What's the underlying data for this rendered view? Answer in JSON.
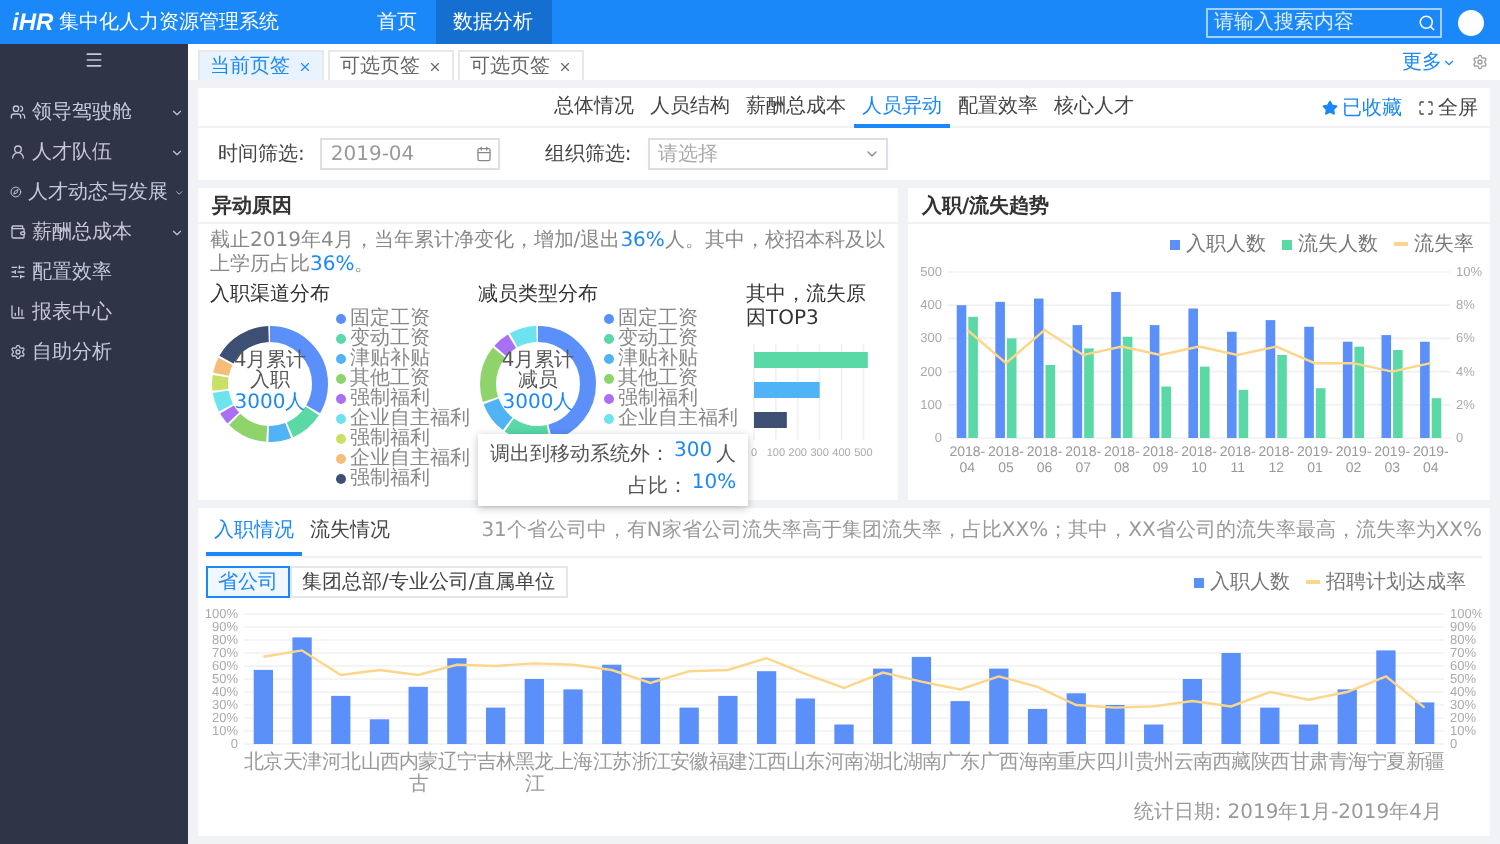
{
  "header": {
    "logo": "iHR",
    "title": "集中化人力资源管理系统",
    "nav": [
      {
        "label": "首页",
        "selected": false
      },
      {
        "label": "数据分析",
        "selected": true
      }
    ],
    "search": {
      "placeholder": "请输入搜索内容"
    }
  },
  "sidebar": {
    "items": [
      {
        "label": "领导驾驶舱",
        "expandable": true
      },
      {
        "label": "人才队伍",
        "expandable": true
      },
      {
        "label": "人才动态与发展",
        "expandable": true
      },
      {
        "label": "薪酬总成本",
        "expandable": true
      },
      {
        "label": "配置效率",
        "expandable": false
      },
      {
        "label": "报表中心",
        "expandable": false
      },
      {
        "label": "自助分析",
        "expandable": false
      }
    ]
  },
  "page_tabs": [
    {
      "label": "当前页签",
      "selected": true
    },
    {
      "label": "可选页签",
      "selected": false
    },
    {
      "label": "可选页签",
      "selected": false
    }
  ],
  "more": "更多",
  "subnav": {
    "tabs": [
      {
        "label": "总体情况",
        "selected": false
      },
      {
        "label": "人员结构",
        "selected": false
      },
      {
        "label": "薪酬总成本",
        "selected": false
      },
      {
        "label": "人员异动",
        "selected": true
      },
      {
        "label": "配置效率",
        "selected": false
      },
      {
        "label": "核心人才",
        "selected": false
      }
    ],
    "favorite": "已收藏",
    "fullscreen": "全屏"
  },
  "filters": [
    {
      "kind": "date",
      "label": "时间筛选:",
      "value": "2019-04"
    },
    {
      "kind": "select",
      "label": "组织筛选:",
      "placeholder": "请选择"
    }
  ],
  "reasons": {
    "title": "异动原因",
    "note": [
      {
        "text": "截止2019年4月，当年累计净变化，增加/退出",
        "highlight": false
      },
      {
        "text": "36%",
        "highlight": true
      },
      {
        "text": "人。其中，校招本科及以上学历占比",
        "highlight": false
      },
      {
        "text": "36%",
        "highlight": true
      },
      {
        "text": "。",
        "highlight": false
      }
    ],
    "donuts": [
      {
        "title": "入职渠道分布",
        "center_label": "4月累计入职",
        "center_value": "3000人",
        "legend": [
          {
            "label": "固定工资",
            "color": "#5b8ff9"
          },
          {
            "label": "变动工资",
            "color": "#5ad8a6"
          },
          {
            "label": "津贴补贴",
            "color": "#4fb3f6"
          },
          {
            "label": "其他工资",
            "color": "#8fd46b"
          },
          {
            "label": "强制福利",
            "color": "#a970f5"
          },
          {
            "label": "企业自主福利",
            "color": "#6de3f0"
          },
          {
            "label": "强制福利",
            "color": "#c8e063"
          },
          {
            "label": "企业自主福利",
            "color": "#f6bd7a"
          },
          {
            "label": "强制福利",
            "color": "#3d4f73"
          }
        ]
      },
      {
        "title": "减员类型分布",
        "center_label": "4月累计减员",
        "center_value": "3000人",
        "legend": [
          {
            "label": "固定工资",
            "color": "#5b8ff9"
          },
          {
            "label": "变动工资",
            "color": "#5ad8a6"
          },
          {
            "label": "津贴补贴",
            "color": "#4fb3f6"
          },
          {
            "label": "其他工资",
            "color": "#8fd46b"
          },
          {
            "label": "强制福利",
            "color": "#a970f5"
          },
          {
            "label": "企业自主福利",
            "color": "#6de3f0"
          }
        ]
      }
    ],
    "tooltip": {
      "rows": [
        {
          "label": "调出到移动系统外：",
          "value": "300",
          "unit": "人"
        },
        {
          "label": "占比：",
          "value": "10%"
        }
      ]
    },
    "top3": {
      "title": "其中，流失原因TOP3",
      "chart_data": {
        "type": "bar",
        "orientation": "horizontal",
        "values": [
          520,
          300,
          150
        ],
        "xlim": [
          0,
          530
        ],
        "xticks": [
          0,
          100,
          200,
          300,
          400,
          500
        ],
        "grid": true
      }
    }
  },
  "trend": {
    "title": "入职/流失趋势",
    "chart_data": {
      "type": "bar",
      "categories": [
        "2018-04",
        "2018-05",
        "2018-06",
        "2018-07",
        "2018-08",
        "2018-09",
        "2018-10",
        "2018-11",
        "2018-12",
        "2019-01",
        "2019-02",
        "2019-03",
        "2019-04"
      ],
      "series": [
        {
          "name": "入职人数",
          "color": "#5b8ff9",
          "values": [
            400,
            410,
            420,
            340,
            440,
            340,
            390,
            320,
            355,
            335,
            290,
            310,
            290
          ]
        },
        {
          "name": "流失人数",
          "color": "#5ad8a6",
          "values": [
            365,
            300,
            220,
            270,
            305,
            155,
            215,
            145,
            250,
            150,
            275,
            265,
            120
          ]
        },
        {
          "name": "流失率",
          "color": "#fcd68a",
          "type": "line",
          "axis": "y2",
          "values": [
            6.5,
            4.5,
            6.5,
            5,
            5.5,
            5,
            5.5,
            5,
            5.5,
            4.5,
            4.5,
            4,
            4.5
          ]
        }
      ],
      "stacked": false,
      "grid": true,
      "ylim": [
        0,
        500
      ],
      "yticks": [
        0,
        100,
        200,
        300,
        400,
        500
      ],
      "y2lim": [
        0,
        10
      ],
      "y2ticks": [
        {
          "value": 0,
          "label": "0"
        },
        {
          "value": 2,
          "label": "2%"
        },
        {
          "value": 4,
          "label": "4%"
        },
        {
          "value": 6,
          "label": "6%"
        },
        {
          "value": 8,
          "label": "8%"
        },
        {
          "value": 10,
          "label": "10%"
        }
      ]
    }
  },
  "bottom": {
    "tabs": [
      {
        "label": "入职情况",
        "selected": true
      },
      {
        "label": "流失情况",
        "selected": false
      }
    ],
    "summary": "31个省公司中，有N家省公司流失率高于集团流失率，占比XX%；其中，XX省公司的流失率最高，流失率为XX%",
    "scopes": [
      {
        "label": "省公司",
        "selected": true
      },
      {
        "label": "集团总部/专业公司/直属单位",
        "selected": false
      }
    ],
    "chart_data": {
      "type": "bar",
      "categories": [
        "北京",
        "天津",
        "河北",
        "山西",
        "内蒙古",
        "辽宁",
        "吉林",
        "黑龙江",
        "上海",
        "江苏",
        "浙江",
        "安徽",
        "福建",
        "江西",
        "山东",
        "河南",
        "湖北",
        "湖南",
        "广东",
        "广西",
        "海南",
        "重庆",
        "四川",
        "贵州",
        "云南",
        "西藏",
        "陕西",
        "甘肃",
        "青海",
        "宁夏",
        "新疆"
      ],
      "series": [
        {
          "name": "入职人数",
          "color": "#5b8ff9",
          "values": [
            57,
            82,
            37,
            19,
            44,
            66,
            28,
            50,
            42,
            61,
            51,
            28,
            37,
            56,
            35,
            15,
            58,
            67,
            33,
            58,
            27,
            39,
            30,
            15,
            50,
            70,
            28,
            15,
            42,
            72,
            32
          ]
        },
        {
          "name": "招聘计划达成率",
          "color": "#fcd68a",
          "type": "line",
          "values": [
            67,
            72,
            53,
            57,
            53,
            61,
            60,
            62,
            61,
            57,
            47,
            56,
            57,
            66,
            54,
            43,
            55,
            48,
            42,
            52,
            44,
            30,
            28,
            29,
            33,
            29,
            40,
            34,
            40,
            52,
            28
          ]
        }
      ],
      "grid": true,
      "ylim": [
        0,
        100
      ],
      "yticks": [
        {
          "value": 0,
          "label": "0"
        },
        {
          "value": 10,
          "label": "10%"
        },
        {
          "value": 20,
          "label": "20%"
        },
        {
          "value": 30,
          "label": "30%"
        },
        {
          "value": 40,
          "label": "40%"
        },
        {
          "value": 50,
          "label": "50%"
        },
        {
          "value": 60,
          "label": "60%"
        },
        {
          "value": 70,
          "label": "70%"
        },
        {
          "value": 80,
          "label": "80%"
        },
        {
          "value": 90,
          "label": "90%"
        },
        {
          "value": 100,
          "label": "100%"
        }
      ],
      "y2lim": [
        0,
        100
      ],
      "y2ticks": [
        {
          "value": 0,
          "label": "0"
        },
        {
          "value": 10,
          "label": "10%"
        },
        {
          "value": 20,
          "label": "20%"
        },
        {
          "value": 30,
          "label": "30%"
        },
        {
          "value": 40,
          "label": "40%"
        },
        {
          "value": 50,
          "label": "50%"
        },
        {
          "value": 60,
          "label": "60%"
        },
        {
          "value": 70,
          "label": "70%"
        },
        {
          "value": 80,
          "label": "80%"
        },
        {
          "value": 90,
          "label": "90%"
        },
        {
          "value": 100,
          "label": "100%"
        }
      ]
    },
    "footnote": "统计日期: 2019年1月-2019年4月"
  }
}
